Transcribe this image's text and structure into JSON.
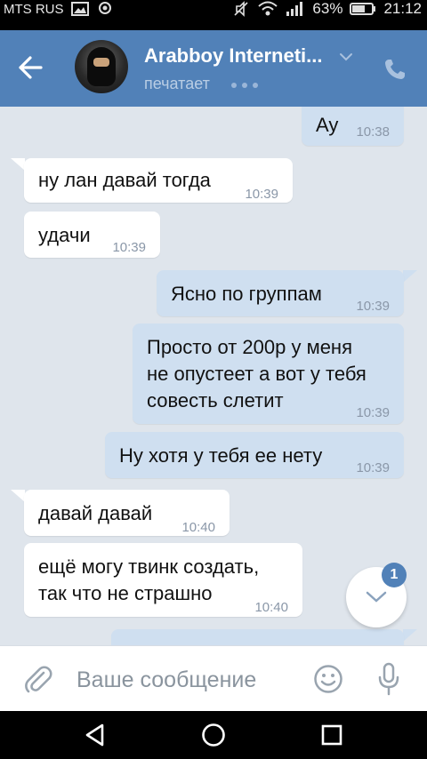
{
  "status_bar": {
    "carrier": "MTS RUS",
    "battery": "63%",
    "time": "21:12",
    "icons": [
      "gallery-icon",
      "location-icon",
      "mute-icon",
      "wifi-icon",
      "signal-icon",
      "battery-icon"
    ]
  },
  "header": {
    "name": "Arabboy Interneti...",
    "status": "печатает",
    "accent": "#5181b8"
  },
  "messages": [
    {
      "dir": "out",
      "text": "Ау",
      "time": "10:38"
    },
    {
      "dir": "in",
      "text": "ну лан давай тогда",
      "time": "10:39"
    },
    {
      "dir": "in",
      "text": "удачи",
      "time": "10:39"
    },
    {
      "dir": "out",
      "text": "Ясно по группам",
      "time": "10:39"
    },
    {
      "dir": "out",
      "lines": [
        "Просто от 200р у меня",
        "не опустеет а вот у тебя",
        "совесть слетит"
      ],
      "time": "10:39"
    },
    {
      "dir": "out",
      "text": "Ну хотя у тебя ее нету",
      "time": "10:39"
    },
    {
      "dir": "in",
      "text": "давай давай",
      "time": "10:40"
    },
    {
      "dir": "in",
      "lines": [
        "ещё могу твинк создать,",
        "так что не страшно"
      ],
      "time": "10:40"
    }
  ],
  "scroll": {
    "unread": "1"
  },
  "composer": {
    "placeholder": "Ваше сообщение"
  },
  "colors": {
    "incoming_bubble": "#ffffff",
    "outgoing_bubble": "#cfdff0",
    "background": "#dfe5ec"
  }
}
